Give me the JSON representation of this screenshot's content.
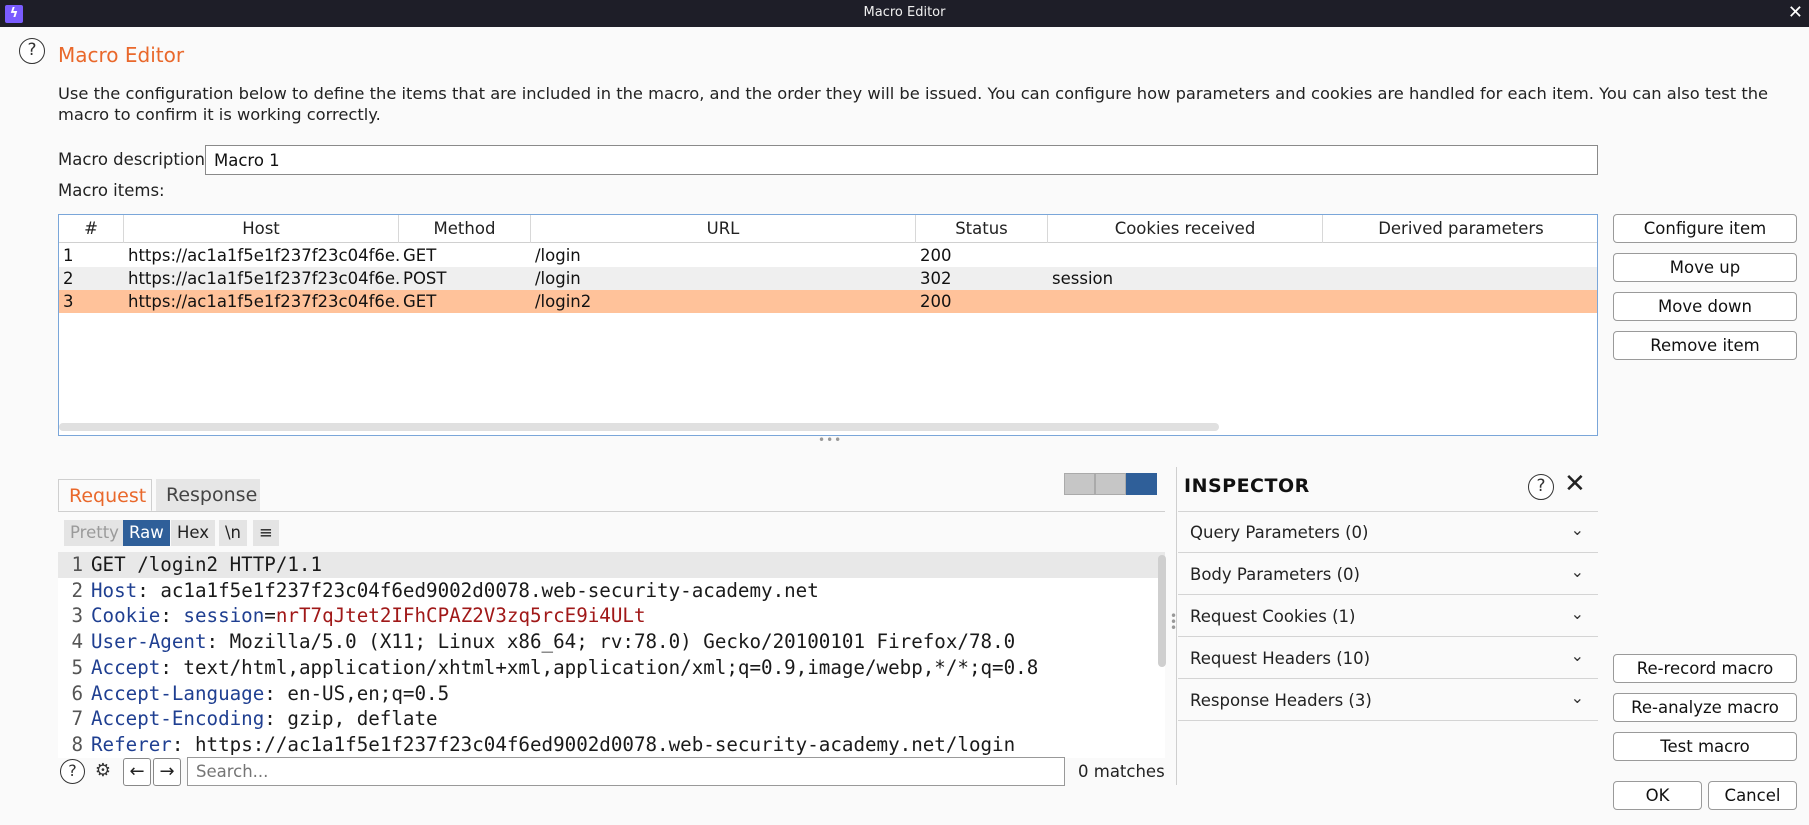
{
  "window": {
    "title": "Macro Editor",
    "icon": "burp-lightning-icon",
    "close_glyph": "✕"
  },
  "heading": "Macro Editor",
  "description": "Use the configuration below to define the items that are included in the macro, and the order they will be issued. You can configure how parameters and cookies are handled for each item. You can also test the macro to confirm it is working correctly.",
  "macro_description": {
    "label": "Macro description:",
    "value": "Macro 1"
  },
  "macro_items": {
    "label": "Macro items:",
    "columns": [
      "#",
      "Host",
      "Method",
      "URL",
      "Status",
      "Cookies received",
      "Derived parameters"
    ],
    "rows": [
      {
        "num": "1",
        "host": "https://ac1a1f5e1f237f23c04f6e...",
        "method": "GET",
        "url": "/login",
        "status": "200",
        "cookies": "",
        "derived": ""
      },
      {
        "num": "2",
        "host": "https://ac1a1f5e1f237f23c04f6e...",
        "method": "POST",
        "url": "/login",
        "status": "302",
        "cookies": "session",
        "derived": ""
      },
      {
        "num": "3",
        "host": "https://ac1a1f5e1f237f23c04f6e...",
        "method": "GET",
        "url": "/login2",
        "status": "200",
        "cookies": "",
        "derived": ""
      }
    ],
    "selected_row": 3
  },
  "item_buttons": {
    "configure": "Configure item",
    "move_up": "Move up",
    "move_down": "Move down",
    "remove": "Remove item"
  },
  "macro_buttons": {
    "rerecord": "Re-record macro",
    "reanalyze": "Re-analyze macro",
    "test": "Test macro"
  },
  "dialog_buttons": {
    "ok": "OK",
    "cancel": "Cancel"
  },
  "tabs": {
    "request": "Request",
    "response": "Response",
    "active": "Request"
  },
  "view_modes": [
    "split-horizontal-icon",
    "split-vertical-icon",
    "single-pane-icon"
  ],
  "format_buttons": {
    "pretty": "Pretty",
    "raw": "Raw",
    "hex": "Hex",
    "newline": "\\n",
    "menu": "≡",
    "active": "Raw"
  },
  "request_lines": [
    {
      "n": "1",
      "key": "",
      "sep": "",
      "value": "GET /login2 HTTP/1.1"
    },
    {
      "n": "2",
      "key": "Host",
      "sep": ": ",
      "value": "ac1a1f5e1f237f23c04f6ed9002d0078.web-security-academy.net"
    },
    {
      "n": "3",
      "key": "Cookie",
      "sep": ": ",
      "cookie_name": "session",
      "cookie_value": "nrT7qJtet2IFhCPAZ2V3zq5rcE9i4ULt"
    },
    {
      "n": "4",
      "key": "User-Agent",
      "sep": ": ",
      "value": "Mozilla/5.0 (X11; Linux x86_64; rv:78.0) Gecko/20100101 Firefox/78.0"
    },
    {
      "n": "5",
      "key": "Accept",
      "sep": ": ",
      "value": "text/html,application/xhtml+xml,application/xml;q=0.9,image/webp,*/*;q=0.8"
    },
    {
      "n": "6",
      "key": "Accept-Language",
      "sep": ": ",
      "value": "en-US,en;q=0.5"
    },
    {
      "n": "7",
      "key": "Accept-Encoding",
      "sep": ": ",
      "value": "gzip, deflate"
    },
    {
      "n": "8",
      "key": "Referer",
      "sep": ": ",
      "value": "https://ac1a1f5e1f237f23c04f6ed9002d0078.web-security-academy.net/login"
    }
  ],
  "search": {
    "placeholder": "Search...",
    "matches": "0 matches"
  },
  "inspector": {
    "title": "INSPECTOR",
    "sections": [
      {
        "label": "Query Parameters (0)"
      },
      {
        "label": "Body Parameters (0)"
      },
      {
        "label": "Request Cookies (1)"
      },
      {
        "label": "Request Headers (10)"
      },
      {
        "label": "Response Headers (3)"
      }
    ]
  },
  "colors": {
    "accent": "#e9682b",
    "selected_row": "#ffc29a",
    "active_toggle": "#2f5f99",
    "header_key": "#1f3f91",
    "cookie_value": "#a01818"
  }
}
